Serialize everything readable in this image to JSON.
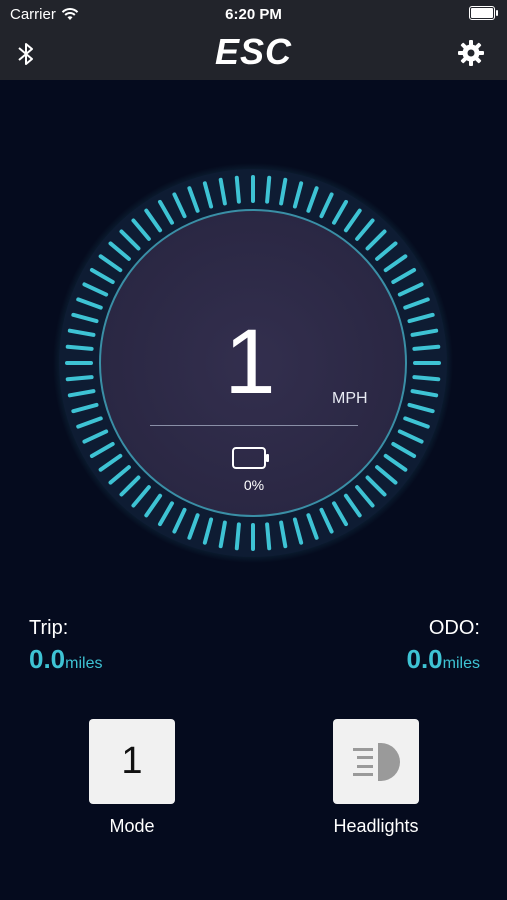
{
  "status_bar": {
    "carrier": "Carrier",
    "time": "6:20 PM"
  },
  "nav": {
    "title": "ESC",
    "left_icon": "bluetooth-icon",
    "right_icon": "gear-icon"
  },
  "gauge": {
    "speed": "1",
    "unit": "MPH",
    "battery_percent": "0%",
    "battery_level": 0,
    "tick_color": "#3ec3d4"
  },
  "trip": {
    "label": "Trip:",
    "value": "0.0",
    "unit": "miles"
  },
  "odo": {
    "label": "ODO:",
    "value": "0.0",
    "unit": "miles"
  },
  "controls": {
    "mode": {
      "value": "1",
      "label": "Mode"
    },
    "headlights": {
      "label": "Headlights",
      "icon": "headlight-icon"
    }
  },
  "colors": {
    "background": "#050b1e",
    "bar": "#22242b",
    "accent": "#3ec3d4"
  }
}
